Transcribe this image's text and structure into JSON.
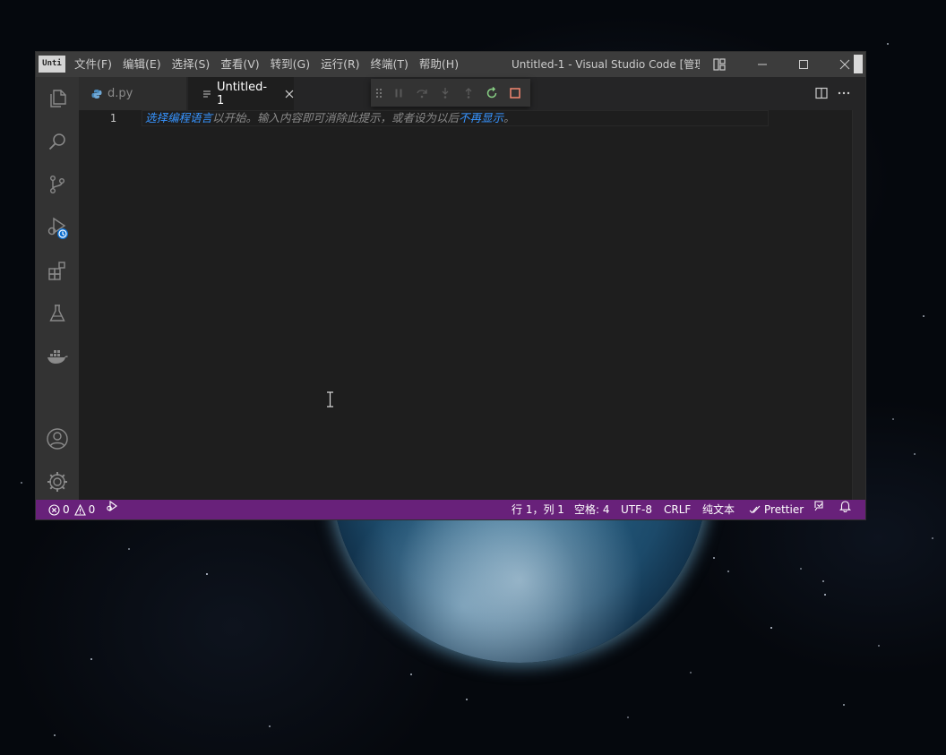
{
  "window": {
    "app_icon_text": "Unti",
    "title": "Untitled-1 - Visual Studio Code [管理..."
  },
  "menu": [
    {
      "label": "文件(F)"
    },
    {
      "label": "编辑(E)"
    },
    {
      "label": "选择(S)"
    },
    {
      "label": "查看(V)"
    },
    {
      "label": "转到(G)"
    },
    {
      "label": "运行(R)"
    },
    {
      "label": "终端(T)"
    },
    {
      "label": "帮助(H)"
    }
  ],
  "activity_bar": {
    "items": [
      "files-icon",
      "search-icon",
      "source-control-icon",
      "run-debug-icon",
      "extensions-icon",
      "testing-icon",
      "docker-icon"
    ],
    "bottom": [
      "account-icon",
      "settings-gear-icon"
    ]
  },
  "tabs": [
    {
      "label": "d.py",
      "active": false
    },
    {
      "label": "Untitled-1",
      "active": true
    }
  ],
  "editor": {
    "line_numbers": [
      "1"
    ],
    "hint": {
      "link1": "选择编程语言",
      "text1": "以开始。输入内容即可消除此提示，或者设为以后",
      "link2": "不再显示",
      "text2": "。"
    }
  },
  "status": {
    "errors": "0",
    "warnings": "0",
    "position": "行 1，列 1",
    "spaces": "空格: 4",
    "encoding": "UTF-8",
    "eol": "CRLF",
    "language": "纯文本",
    "formatter": "Prettier"
  },
  "colors": {
    "statusbar": "#68217a",
    "titlebar": "#3c3c3c",
    "activitybar": "#333333",
    "editor": "#1e1e1e",
    "link": "#3794ff"
  }
}
